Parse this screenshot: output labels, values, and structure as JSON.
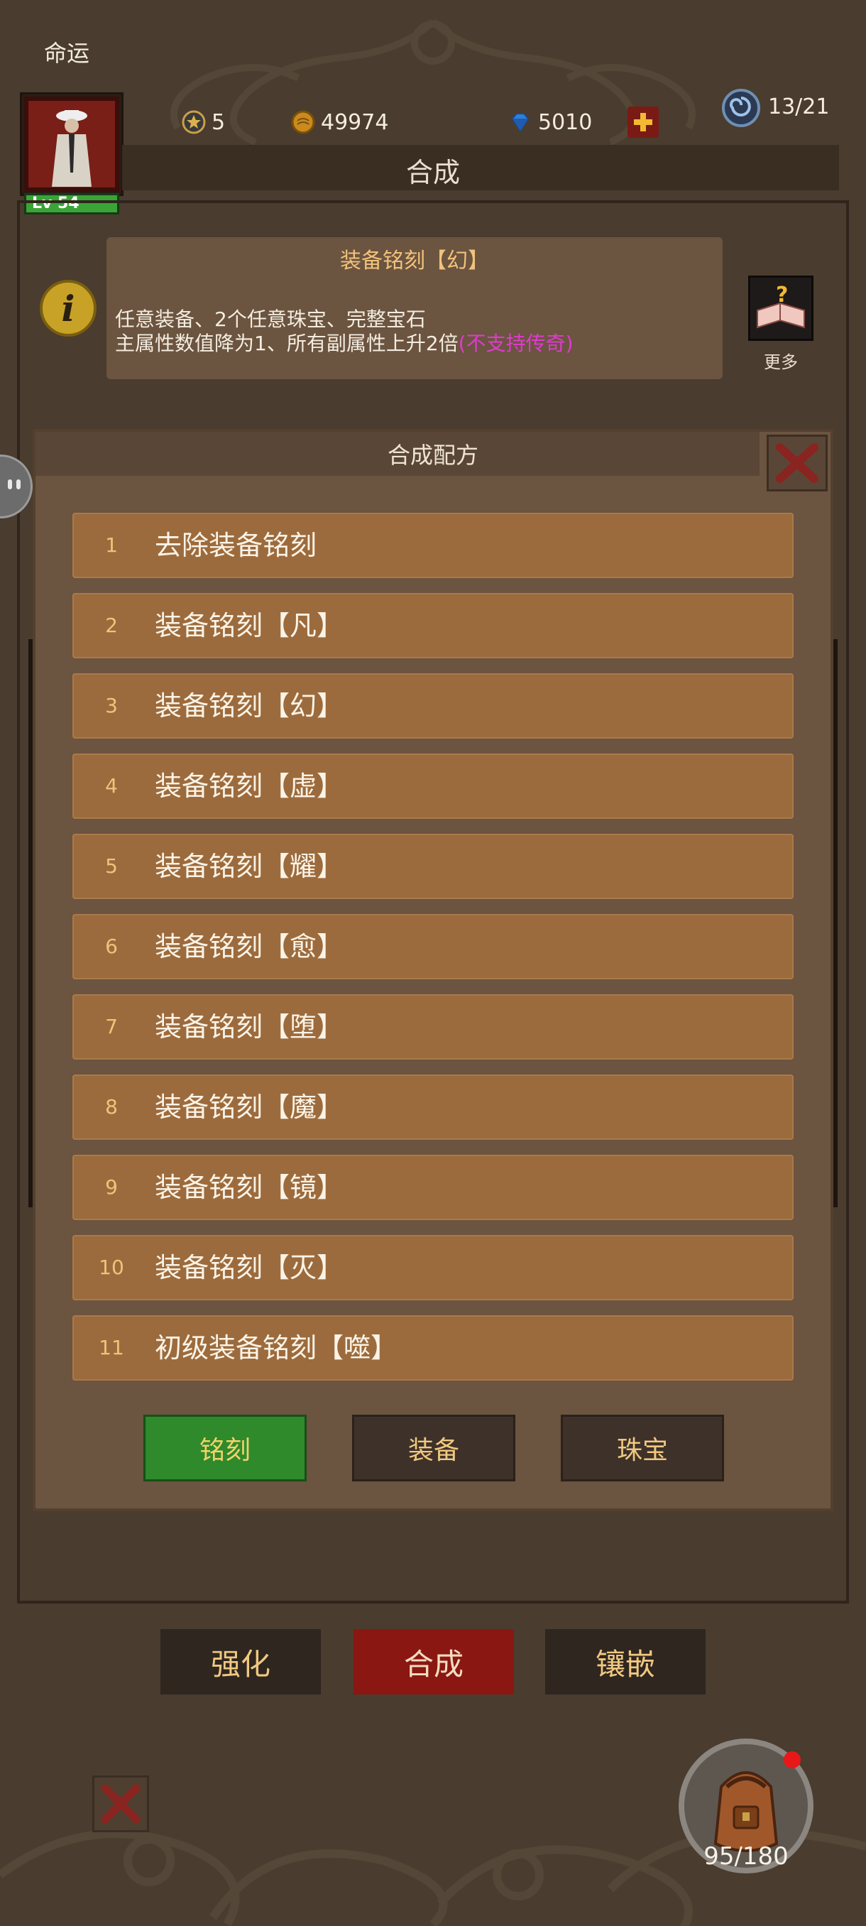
{
  "app": {
    "title": "命运"
  },
  "player": {
    "level": "Lv 54"
  },
  "currencies": [
    {
      "icon": "star-medal-icon",
      "value": "5"
    },
    {
      "icon": "gold-coin-icon",
      "value": "49974"
    },
    {
      "icon": "diamond-icon",
      "value": "5010"
    }
  ],
  "stamina": {
    "value": "13/21"
  },
  "header": {
    "title": "合成"
  },
  "info": {
    "title": "装备铭刻【幻】",
    "line1": "任意装备、2个任意珠宝、完整宝石",
    "line2": "主属性数值降为1、所有副属性上升2倍",
    "line2_highlight": "(不支持传奇)",
    "more_label": "更多"
  },
  "modal": {
    "title": "合成配方",
    "recipes": [
      {
        "num": "1",
        "name": "去除装备铭刻"
      },
      {
        "num": "2",
        "name": "装备铭刻【凡】"
      },
      {
        "num": "3",
        "name": "装备铭刻【幻】"
      },
      {
        "num": "4",
        "name": "装备铭刻【虚】"
      },
      {
        "num": "5",
        "name": "装备铭刻【耀】"
      },
      {
        "num": "6",
        "name": "装备铭刻【愈】"
      },
      {
        "num": "7",
        "name": "装备铭刻【堕】"
      },
      {
        "num": "8",
        "name": "装备铭刻【魔】"
      },
      {
        "num": "9",
        "name": "装备铭刻【镜】"
      },
      {
        "num": "10",
        "name": "装备铭刻【灭】"
      },
      {
        "num": "11",
        "name": "初级装备铭刻【噬】"
      }
    ],
    "tabs": [
      {
        "label": "铭刻",
        "active": true
      },
      {
        "label": "装备",
        "active": false
      },
      {
        "label": "珠宝",
        "active": false
      }
    ]
  },
  "bottom_nav": [
    {
      "label": "强化",
      "active": false
    },
    {
      "label": "合成",
      "active": true
    },
    {
      "label": "镶嵌",
      "active": false
    }
  ],
  "bag": {
    "count": "95/180",
    "has_notification": true
  },
  "colors": {
    "background": "#4a3c2e",
    "panel": "#6b5440",
    "recipe_row": "#9c6b3d",
    "active_tab_green": "#2f8a2c",
    "active_nav_red": "#8a1712",
    "highlight_pink": "#e03ad0",
    "gold_text": "#f1c27a"
  }
}
